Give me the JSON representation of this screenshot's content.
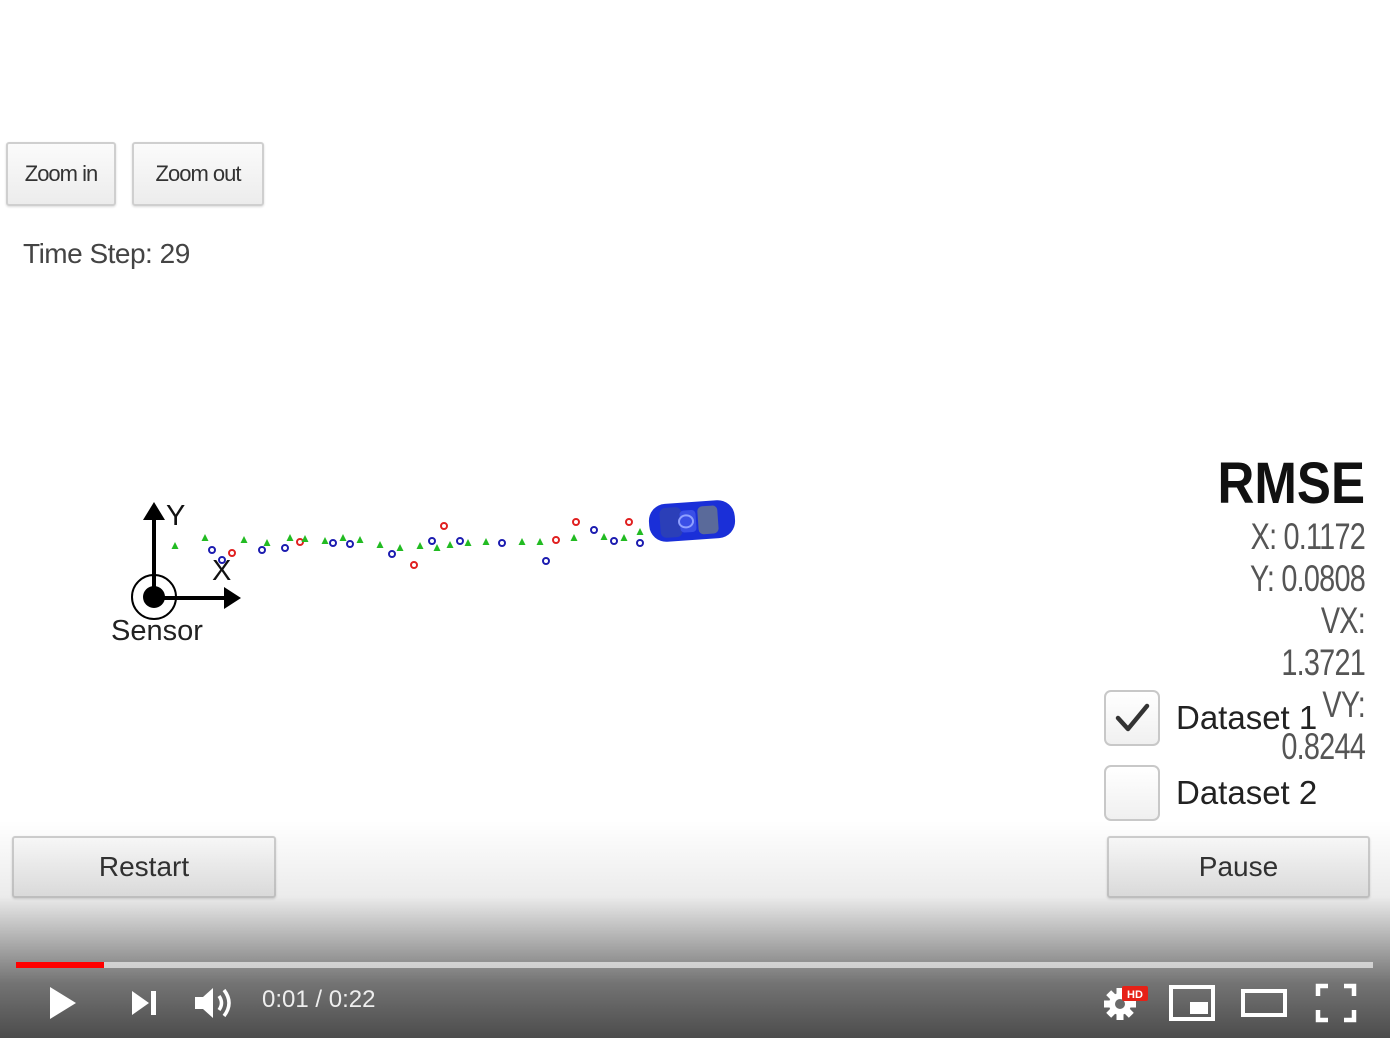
{
  "toolbar": {
    "zoom_in_label": "Zoom in",
    "zoom_out_label": "Zoom out"
  },
  "time_step": "Time Step: 29",
  "sensor": {
    "label": "Sensor",
    "axis_y": "Y",
    "axis_x": "X"
  },
  "rmse": {
    "title": "RMSE",
    "x": "X: 0.1172",
    "y": "Y: 0.0808",
    "vx": "VX: 1.3721",
    "vy": "VY: 0.8244"
  },
  "datasets": [
    {
      "label": "Dataset 1",
      "checked": true
    },
    {
      "label": "Dataset 2",
      "checked": false
    }
  ],
  "controls": {
    "restart_label": "Restart",
    "pause_label": "Pause"
  },
  "player": {
    "current_time": "0:01",
    "separator": " / ",
    "duration": "0:22",
    "progress": 0.065,
    "hd_badge": "HD",
    "accent_color": "#ff0000"
  },
  "markers": {
    "colors": {
      "lidar": "#e02020",
      "radar": "#1c1cb0",
      "estimate": "#22bb22"
    },
    "icons": [
      "car-icon",
      "sensor-origin-icon"
    ]
  }
}
